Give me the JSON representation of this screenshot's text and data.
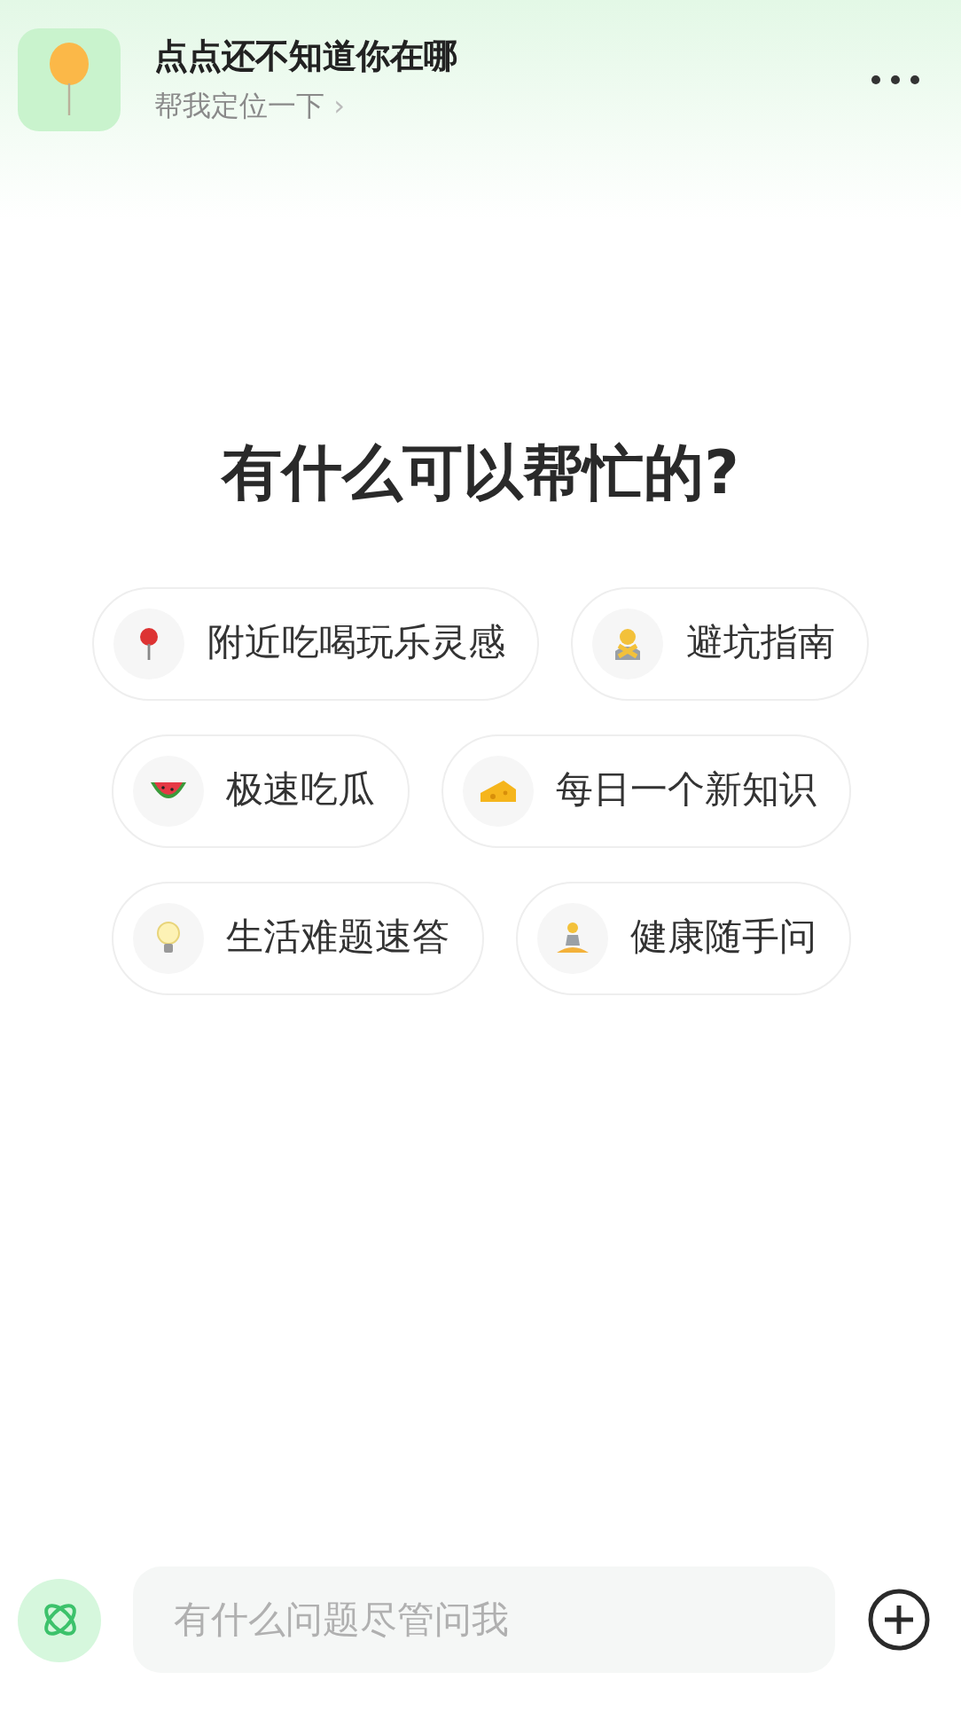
{
  "header": {
    "title": "点点还不知道你在哪",
    "subtitle": "帮我定位一下",
    "subtitle_arrow": "›"
  },
  "heading": "有什么可以帮忙的?",
  "suggestion_rows": [
    [
      {
        "label": "附近吃喝玩乐灵感"
      },
      {
        "label": "避坑指南"
      }
    ],
    [
      {
        "label": "极速吃瓜"
      },
      {
        "label": "每日一个新知识"
      }
    ],
    [
      {
        "label": "生活难题速答"
      },
      {
        "label": "健康随手问"
      }
    ]
  ],
  "input": {
    "placeholder": "有什么问题尽管问我"
  }
}
